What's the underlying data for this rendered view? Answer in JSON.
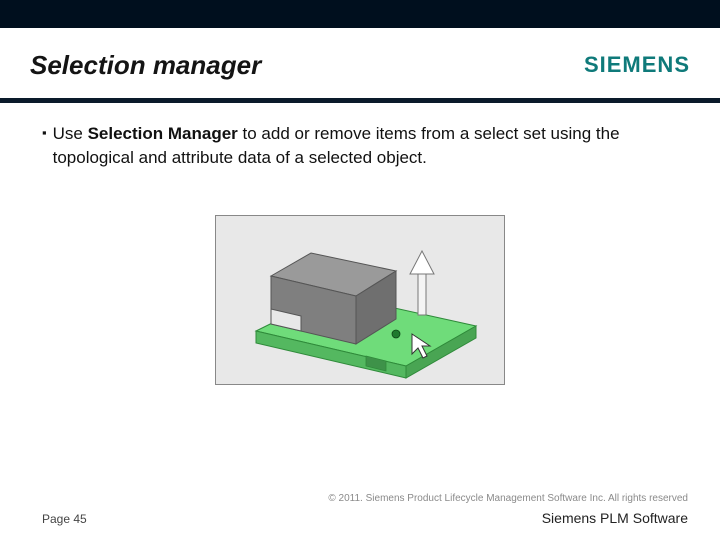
{
  "header": {
    "title": "Selection manager",
    "logo": "SIEMENS"
  },
  "body": {
    "bullet_prefix": "Use ",
    "bullet_strong": "Selection Manager",
    "bullet_rest": " to add or remove items from a select set using the topological and attribute data of a selected object."
  },
  "footer": {
    "copyright": "© 2011. Siemens Product Lifecycle Management Software Inc. All rights reserved",
    "page": "Page 45",
    "brand": "Siemens PLM Software"
  },
  "figure": {
    "alt": "3D CAD illustration: a gray block sits on a green base; a white arrow points upward from the selected top face; a mouse cursor is shown near the arrow."
  }
}
